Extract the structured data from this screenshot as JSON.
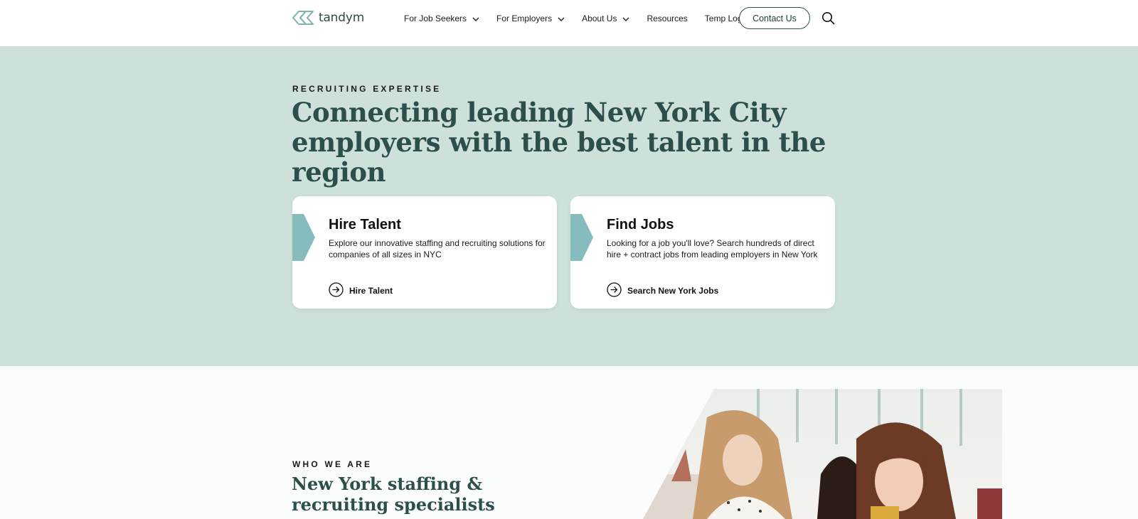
{
  "header": {
    "logo_text": "tandym",
    "nav": [
      {
        "label": "For Job Seekers",
        "has_dropdown": true
      },
      {
        "label": "For Employers",
        "has_dropdown": true
      },
      {
        "label": "About Us",
        "has_dropdown": true
      },
      {
        "label": "Resources",
        "has_dropdown": false
      },
      {
        "label": "Temp Login",
        "has_dropdown": false
      }
    ],
    "contact_label": "Contact Us",
    "search_icon": "search-icon"
  },
  "hero": {
    "eyebrow": "RECRUITING EXPERTISE",
    "title": "Connecting leading New York City employers with the best talent in the region",
    "cards": [
      {
        "title": "Hire Talent",
        "description": "Explore our innovative staffing and recruiting solutions for companies of all sizes in NYC",
        "link_label": "Hire Talent",
        "link_icon": "arrow-circle-icon"
      },
      {
        "title": "Find Jobs",
        "description": "Looking for a job you'll love? Search hundreds of direct hire + contract jobs from leading employers in New York",
        "link_label": "Search New York Jobs",
        "link_icon": "arrow-circle-icon"
      }
    ]
  },
  "who": {
    "eyebrow": "WHO WE ARE",
    "title": "New York staffing & recruiting specialists"
  },
  "colors": {
    "hero_bg": "#cde0da",
    "heading": "#2c4f4c",
    "accent_teal": "#86bcbd",
    "page_bg": "#fbfcfc"
  }
}
